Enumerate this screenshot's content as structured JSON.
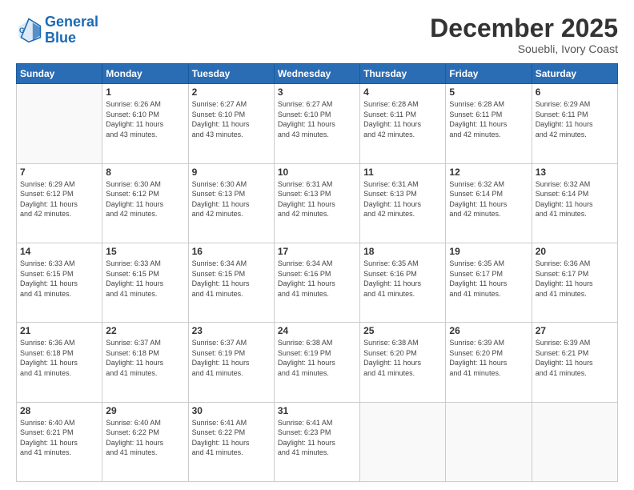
{
  "logo": {
    "text1": "General",
    "text2": "Blue"
  },
  "header": {
    "month": "December 2025",
    "location": "Souebli, Ivory Coast"
  },
  "weekdays": [
    "Sunday",
    "Monday",
    "Tuesday",
    "Wednesday",
    "Thursday",
    "Friday",
    "Saturday"
  ],
  "weeks": [
    [
      {
        "day": "",
        "info": ""
      },
      {
        "day": "1",
        "info": "Sunrise: 6:26 AM\nSunset: 6:10 PM\nDaylight: 11 hours\nand 43 minutes."
      },
      {
        "day": "2",
        "info": "Sunrise: 6:27 AM\nSunset: 6:10 PM\nDaylight: 11 hours\nand 43 minutes."
      },
      {
        "day": "3",
        "info": "Sunrise: 6:27 AM\nSunset: 6:10 PM\nDaylight: 11 hours\nand 43 minutes."
      },
      {
        "day": "4",
        "info": "Sunrise: 6:28 AM\nSunset: 6:11 PM\nDaylight: 11 hours\nand 42 minutes."
      },
      {
        "day": "5",
        "info": "Sunrise: 6:28 AM\nSunset: 6:11 PM\nDaylight: 11 hours\nand 42 minutes."
      },
      {
        "day": "6",
        "info": "Sunrise: 6:29 AM\nSunset: 6:11 PM\nDaylight: 11 hours\nand 42 minutes."
      }
    ],
    [
      {
        "day": "7",
        "info": "Sunrise: 6:29 AM\nSunset: 6:12 PM\nDaylight: 11 hours\nand 42 minutes."
      },
      {
        "day": "8",
        "info": "Sunrise: 6:30 AM\nSunset: 6:12 PM\nDaylight: 11 hours\nand 42 minutes."
      },
      {
        "day": "9",
        "info": "Sunrise: 6:30 AM\nSunset: 6:13 PM\nDaylight: 11 hours\nand 42 minutes."
      },
      {
        "day": "10",
        "info": "Sunrise: 6:31 AM\nSunset: 6:13 PM\nDaylight: 11 hours\nand 42 minutes."
      },
      {
        "day": "11",
        "info": "Sunrise: 6:31 AM\nSunset: 6:13 PM\nDaylight: 11 hours\nand 42 minutes."
      },
      {
        "day": "12",
        "info": "Sunrise: 6:32 AM\nSunset: 6:14 PM\nDaylight: 11 hours\nand 42 minutes."
      },
      {
        "day": "13",
        "info": "Sunrise: 6:32 AM\nSunset: 6:14 PM\nDaylight: 11 hours\nand 41 minutes."
      }
    ],
    [
      {
        "day": "14",
        "info": "Sunrise: 6:33 AM\nSunset: 6:15 PM\nDaylight: 11 hours\nand 41 minutes."
      },
      {
        "day": "15",
        "info": "Sunrise: 6:33 AM\nSunset: 6:15 PM\nDaylight: 11 hours\nand 41 minutes."
      },
      {
        "day": "16",
        "info": "Sunrise: 6:34 AM\nSunset: 6:15 PM\nDaylight: 11 hours\nand 41 minutes."
      },
      {
        "day": "17",
        "info": "Sunrise: 6:34 AM\nSunset: 6:16 PM\nDaylight: 11 hours\nand 41 minutes."
      },
      {
        "day": "18",
        "info": "Sunrise: 6:35 AM\nSunset: 6:16 PM\nDaylight: 11 hours\nand 41 minutes."
      },
      {
        "day": "19",
        "info": "Sunrise: 6:35 AM\nSunset: 6:17 PM\nDaylight: 11 hours\nand 41 minutes."
      },
      {
        "day": "20",
        "info": "Sunrise: 6:36 AM\nSunset: 6:17 PM\nDaylight: 11 hours\nand 41 minutes."
      }
    ],
    [
      {
        "day": "21",
        "info": "Sunrise: 6:36 AM\nSunset: 6:18 PM\nDaylight: 11 hours\nand 41 minutes."
      },
      {
        "day": "22",
        "info": "Sunrise: 6:37 AM\nSunset: 6:18 PM\nDaylight: 11 hours\nand 41 minutes."
      },
      {
        "day": "23",
        "info": "Sunrise: 6:37 AM\nSunset: 6:19 PM\nDaylight: 11 hours\nand 41 minutes."
      },
      {
        "day": "24",
        "info": "Sunrise: 6:38 AM\nSunset: 6:19 PM\nDaylight: 11 hours\nand 41 minutes."
      },
      {
        "day": "25",
        "info": "Sunrise: 6:38 AM\nSunset: 6:20 PM\nDaylight: 11 hours\nand 41 minutes."
      },
      {
        "day": "26",
        "info": "Sunrise: 6:39 AM\nSunset: 6:20 PM\nDaylight: 11 hours\nand 41 minutes."
      },
      {
        "day": "27",
        "info": "Sunrise: 6:39 AM\nSunset: 6:21 PM\nDaylight: 11 hours\nand 41 minutes."
      }
    ],
    [
      {
        "day": "28",
        "info": "Sunrise: 6:40 AM\nSunset: 6:21 PM\nDaylight: 11 hours\nand 41 minutes."
      },
      {
        "day": "29",
        "info": "Sunrise: 6:40 AM\nSunset: 6:22 PM\nDaylight: 11 hours\nand 41 minutes."
      },
      {
        "day": "30",
        "info": "Sunrise: 6:41 AM\nSunset: 6:22 PM\nDaylight: 11 hours\nand 41 minutes."
      },
      {
        "day": "31",
        "info": "Sunrise: 6:41 AM\nSunset: 6:23 PM\nDaylight: 11 hours\nand 41 minutes."
      },
      {
        "day": "",
        "info": ""
      },
      {
        "day": "",
        "info": ""
      },
      {
        "day": "",
        "info": ""
      }
    ]
  ]
}
